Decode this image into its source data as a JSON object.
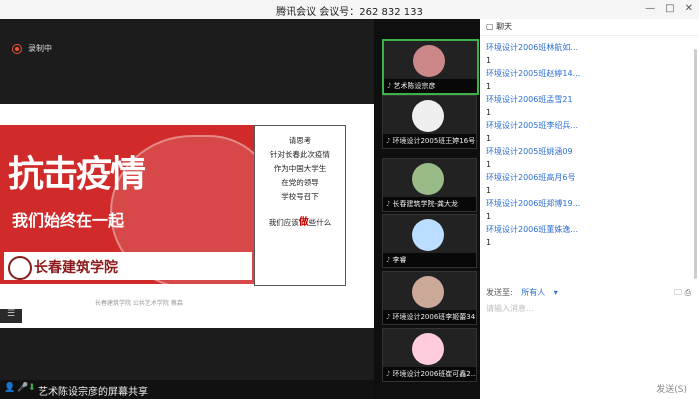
{
  "window": {
    "title": "腾讯会议 会议号：262 832 133",
    "controls": [
      "—",
      "□",
      "✕"
    ]
  },
  "recording": {
    "label": "录制中"
  },
  "slide": {
    "big_text": "抗击疫情",
    "sub_text": "我们始终在一起",
    "logo_text": "长春建筑学院",
    "lines": [
      "请思考",
      "针对长春此次疫情",
      "作为中国大学生",
      "在党的领导",
      "学校号召下"
    ],
    "final_pre": "我们应该",
    "final_emph": "做",
    "final_post": "些什么",
    "footer": "长春建筑学院  公共艺术学院  蔡森"
  },
  "share_bar": {
    "label": "艺术陈设宗彦的屏幕共享"
  },
  "participants": [
    {
      "name": "艺术陈设宗彦",
      "active": true
    },
    {
      "name": "环境设计2005班王婷16号",
      "active": false
    },
    {
      "name": "长春建筑学院-龚大龙",
      "active": false
    },
    {
      "name": "李睿",
      "active": false
    },
    {
      "name": "环境设计2006班李姬蕾34",
      "active": false
    },
    {
      "name": "环境设计2006班崔可鑫2...",
      "active": false
    }
  ],
  "chat": {
    "title": "聊天",
    "messages": [
      {
        "name": "环境设计2006班林航如...",
        "text": "1"
      },
      {
        "name": "环境设计2005班赵婷14...",
        "text": "1"
      },
      {
        "name": "环境设计2006班孟雪21",
        "text": "1"
      },
      {
        "name": "环境设计2005班李绍兵...",
        "text": "1"
      },
      {
        "name": "环境设计2005班姚涵09",
        "text": "1"
      },
      {
        "name": "环境设计2006班高月6号",
        "text": "1"
      },
      {
        "name": "环境设计2006班郑博19...",
        "text": "1"
      },
      {
        "name": "环境设计2006班董姝逸...",
        "text": "1"
      }
    ],
    "send_to_label": "发送至:",
    "send_to_value": "所有人",
    "placeholder": "请输入消息...",
    "send_button": "发送(S)"
  }
}
